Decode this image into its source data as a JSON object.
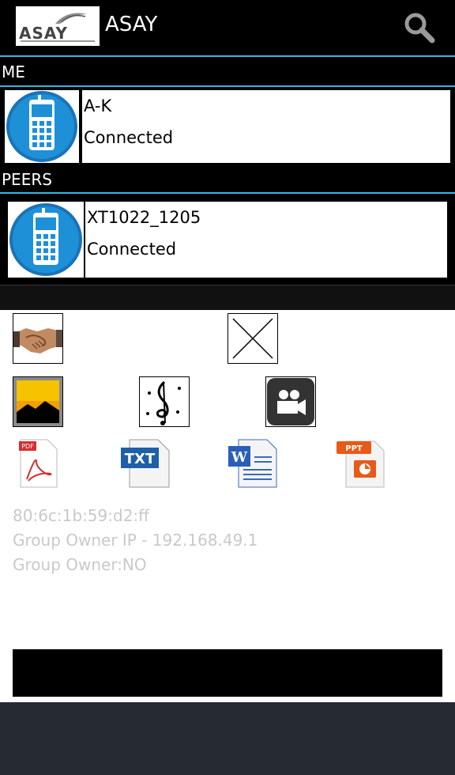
{
  "header": {
    "logo_text": "ASAY",
    "title": "ASAY"
  },
  "sections": {
    "me_label": "ME",
    "peers_label": "PEERS"
  },
  "me_device": {
    "name": "A-K",
    "status": "Connected"
  },
  "peer_devices": [
    {
      "name": "XT1022_1205",
      "status": "Connected"
    }
  ],
  "file_icons": {
    "pdf_label": "PDF",
    "txt_label": "TXT",
    "word_label": "W",
    "ppt_label": "PPT"
  },
  "info": {
    "mac": "80:6c:1b:59:d2:ff",
    "owner_ip": "Group Owner IP - 192.168.49.1",
    "owner": "Group Owner:NO"
  },
  "colors": {
    "accent": "#33b5e5",
    "background": "#000000",
    "info_text": "#c9c9c9"
  }
}
